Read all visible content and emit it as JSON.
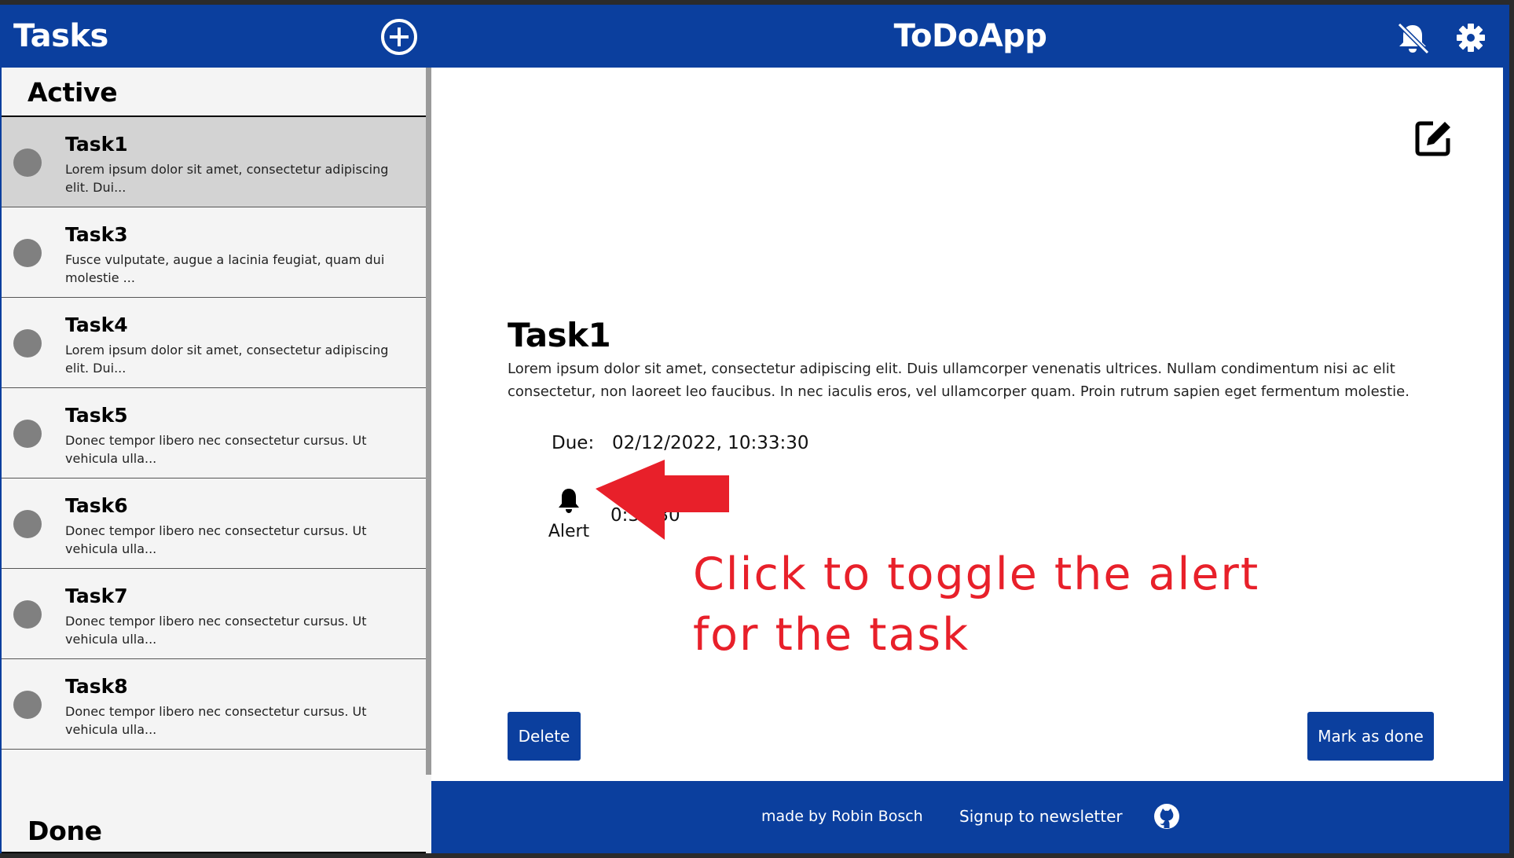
{
  "header": {
    "sidebar_title": "Tasks",
    "app_title": "ToDoApp",
    "icons": [
      "plus-circle-icon",
      "bell-off-icon",
      "gear-icon"
    ]
  },
  "sidebar": {
    "active_heading": "Active",
    "done_heading": "Done",
    "tasks": [
      {
        "title": "Task1",
        "desc": "Lorem ipsum dolor sit amet, consectetur adipiscing elit. Dui...",
        "selected": true
      },
      {
        "title": "Task3",
        "desc": "Fusce vulputate, augue a lacinia feugiat, quam dui molestie ..."
      },
      {
        "title": "Task4",
        "desc": "Lorem ipsum dolor sit amet, consectetur adipiscing elit. Dui..."
      },
      {
        "title": "Task5",
        "desc": "Donec tempor libero nec consectetur cursus. Ut vehicula ulla..."
      },
      {
        "title": "Task6",
        "desc": "Donec tempor libero nec consectetur cursus. Ut vehicula ulla..."
      },
      {
        "title": "Task7",
        "desc": "Donec tempor libero nec consectetur cursus. Ut vehicula ulla..."
      },
      {
        "title": "Task8",
        "desc": "Donec tempor libero nec consectetur cursus. Ut vehicula ulla..."
      }
    ]
  },
  "detail": {
    "title": "Task1",
    "description": "Lorem ipsum dolor sit amet, consectetur adipiscing elit. Duis ullamcorper venenatis ultrices. Nullam condimentum nisi ac elit consectetur, non laoreet leo faucibus. In nec iaculis eros, vel ullamcorper quam. Proin rutrum sapien eget fermentum molestie.",
    "due_label": "Due:",
    "due_value": "02/12/2022, 10:33:30",
    "alert_label": "Alert",
    "alert_value": "0:33:30",
    "delete_label": "Delete",
    "mark_done_label": "Mark as done"
  },
  "annotation": {
    "text": "Click to toggle the alert for the task",
    "color": "#e8202a"
  },
  "footer": {
    "credit": "made by Robin Bosch",
    "newsletter": "Signup to newsletter"
  },
  "colors": {
    "primary": "#0b3f9e",
    "selected_row": "#d3d3d3",
    "dot": "#808080"
  }
}
